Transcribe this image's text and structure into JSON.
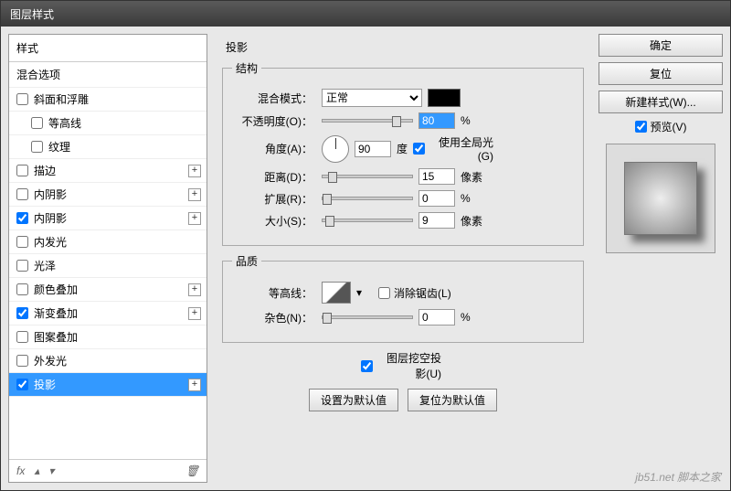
{
  "window": {
    "title": "图层样式"
  },
  "left": {
    "header": "样式",
    "sub": "混合选项",
    "items": [
      {
        "label": "斜面和浮雕",
        "checked": false,
        "plus": false
      },
      {
        "label": "等高线",
        "checked": false,
        "plus": false,
        "indent": true
      },
      {
        "label": "纹理",
        "checked": false,
        "plus": false,
        "indent": true
      },
      {
        "label": "描边",
        "checked": false,
        "plus": true
      },
      {
        "label": "内阴影",
        "checked": false,
        "plus": true
      },
      {
        "label": "内阴影",
        "checked": true,
        "plus": true
      },
      {
        "label": "内发光",
        "checked": false,
        "plus": false
      },
      {
        "label": "光泽",
        "checked": false,
        "plus": false
      },
      {
        "label": "颜色叠加",
        "checked": false,
        "plus": true
      },
      {
        "label": "渐变叠加",
        "checked": true,
        "plus": true
      },
      {
        "label": "图案叠加",
        "checked": false,
        "plus": false
      },
      {
        "label": "外发光",
        "checked": false,
        "plus": false
      },
      {
        "label": "投影",
        "checked": true,
        "plus": true,
        "selected": true
      }
    ],
    "footer_fx": "fx"
  },
  "center": {
    "title": "投影",
    "group_structure": "结构",
    "blend_mode_label": "混合模式：",
    "blend_mode_value": "正常",
    "opacity_label": "不透明度(O)：",
    "opacity_value": "80",
    "opacity_unit": "%",
    "angle_label": "角度(A)：",
    "angle_value": "90",
    "angle_unit": "度",
    "global_light_label": "使用全局光(G)",
    "global_light_checked": true,
    "distance_label": "距离(D)：",
    "distance_value": "15",
    "distance_unit": "像素",
    "spread_label": "扩展(R)：",
    "spread_value": "0",
    "spread_unit": "%",
    "size_label": "大小(S)：",
    "size_value": "9",
    "size_unit": "像素",
    "group_quality": "品质",
    "contour_label": "等高线：",
    "antialias_label": "消除锯齿(L)",
    "antialias_checked": false,
    "noise_label": "杂色(N)：",
    "noise_value": "0",
    "noise_unit": "%",
    "knockout_label": "图层挖空投影(U)",
    "knockout_checked": true,
    "make_default": "设置为默认值",
    "reset_default": "复位为默认值"
  },
  "right": {
    "ok": "确定",
    "cancel": "复位",
    "new_style": "新建样式(W)...",
    "preview_label": "预览(V)",
    "preview_checked": true
  },
  "watermark": {
    "site": "jb51.net",
    "name": "脚本之家"
  }
}
